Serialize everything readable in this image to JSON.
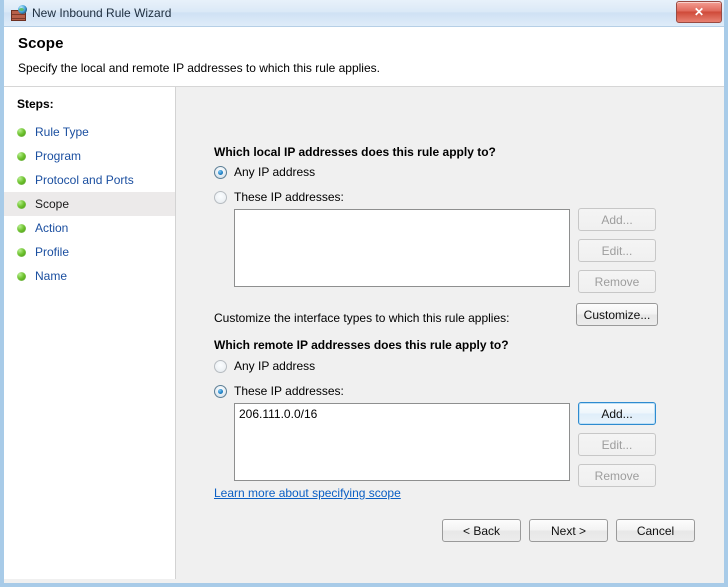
{
  "window": {
    "title": "New Inbound Rule Wizard",
    "icon": "firewall-brick-globe-icon",
    "close_label": "✕",
    "accent_blue": "#a8cbe8",
    "close_red": "#cf4a39"
  },
  "header": {
    "title": "Scope",
    "subtitle": "Specify the local and remote IP addresses to which this rule applies."
  },
  "sidebar": {
    "heading": "Steps:",
    "items": [
      {
        "label": "Rule Type",
        "selected": false
      },
      {
        "label": "Program",
        "selected": false
      },
      {
        "label": "Protocol and Ports",
        "selected": false
      },
      {
        "label": "Scope",
        "selected": true
      },
      {
        "label": "Action",
        "selected": false
      },
      {
        "label": "Profile",
        "selected": false
      },
      {
        "label": "Name",
        "selected": false
      }
    ]
  },
  "local": {
    "question": "Which local IP addresses does this rule apply to?",
    "any_label": "Any IP address",
    "these_label": "These IP addresses:",
    "selected": "any",
    "addresses": [],
    "add_label": "Add...",
    "edit_label": "Edit...",
    "remove_label": "Remove"
  },
  "interface": {
    "text": "Customize the interface types to which this rule applies:",
    "customize_label": "Customize..."
  },
  "remote": {
    "question": "Which remote IP addresses does this rule apply to?",
    "any_label": "Any IP address",
    "these_label": "These IP addresses:",
    "selected": "these",
    "addresses": [
      "206.111.0.0/16"
    ],
    "add_label": "Add...",
    "edit_label": "Edit...",
    "remove_label": "Remove"
  },
  "learn_more": {
    "label": "Learn more about specifying scope"
  },
  "footer": {
    "back_label": "< Back",
    "next_label": "Next >",
    "cancel_label": "Cancel"
  }
}
